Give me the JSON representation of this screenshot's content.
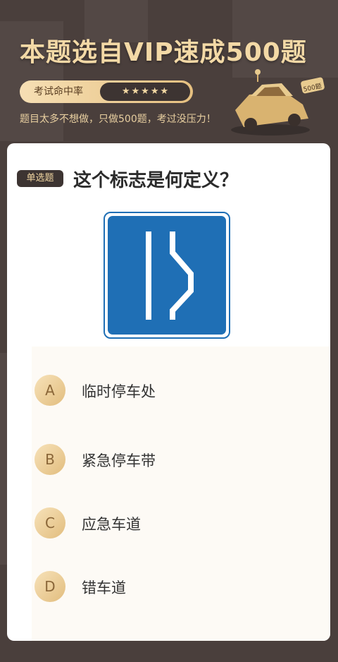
{
  "promo": {
    "title": "本题选自VIP速成500题",
    "hit_rate_label": "考试命中率",
    "stars": [
      "★",
      "★",
      "★",
      "★",
      "★"
    ],
    "subtext": "题目太多不想做，只做500题，考过没压力！",
    "car_badge": "500题"
  },
  "question": {
    "type_badge": "单选题",
    "text": "这个标志是何定义？",
    "image_icon": "lane-narrowing-road-sign"
  },
  "options": [
    {
      "letter": "A",
      "text": "临时停车处"
    },
    {
      "letter": "B",
      "text": "紧急停车带"
    },
    {
      "letter": "C",
      "text": "应急车道"
    },
    {
      "letter": "D",
      "text": "错车道"
    }
  ],
  "colors": {
    "background": "#4a3f3c",
    "gold": "#f3d9a6",
    "sign_blue": "#1f6fb5"
  }
}
